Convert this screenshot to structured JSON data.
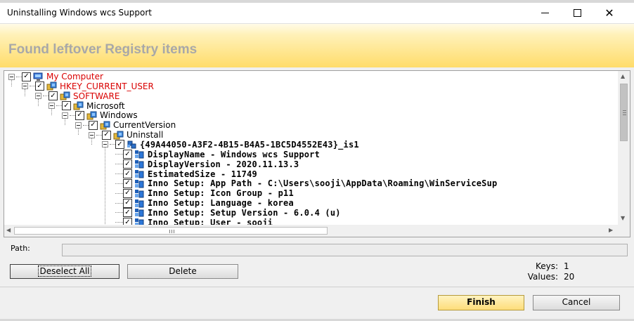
{
  "window": {
    "title": "Uninstalling Windows wcs Support",
    "minimize_icon": "minimize-icon",
    "maximize_icon": "maximize-icon",
    "close_icon": "close-icon"
  },
  "header": {
    "title": "Found leftover Registry items"
  },
  "tree": {
    "nodes": [
      {
        "label": "My Computer",
        "icon": "computer-icon",
        "checked": true,
        "style": "red"
      },
      {
        "label": "HKEY_CURRENT_USER",
        "icon": "registry-folder-icon",
        "checked": true,
        "style": "red"
      },
      {
        "label": "SOFTWARE",
        "icon": "registry-folder-icon",
        "checked": true,
        "style": "red"
      },
      {
        "label": "Microsoft",
        "icon": "registry-folder-icon",
        "checked": true,
        "style": "normal"
      },
      {
        "label": "Windows",
        "icon": "registry-folder-icon",
        "checked": true,
        "style": "normal"
      },
      {
        "label": "CurrentVersion",
        "icon": "registry-folder-icon",
        "checked": true,
        "style": "normal"
      },
      {
        "label": "Uninstall",
        "icon": "registry-folder-icon",
        "checked": true,
        "style": "normal"
      },
      {
        "label": "{49A44050-A3F2-4B15-B4A5-1BC5D4552E43}_is1",
        "icon": "registry-key-icon",
        "checked": true,
        "style": "mono"
      },
      {
        "label": "DisplayName - Windows wcs Support",
        "icon": "registry-value-icon",
        "checked": true,
        "style": "mono"
      },
      {
        "label": "DisplayVersion - 2020.11.13.3",
        "icon": "registry-value-icon",
        "checked": true,
        "style": "mono"
      },
      {
        "label": "EstimatedSize - 11749",
        "icon": "registry-value-icon",
        "checked": true,
        "style": "mono"
      },
      {
        "label": "Inno Setup: App Path - C:\\Users\\sooji\\AppData\\Roaming\\WinServiceSup",
        "icon": "registry-value-icon",
        "checked": true,
        "style": "mono"
      },
      {
        "label": "Inno Setup: Icon Group - p11",
        "icon": "registry-value-icon",
        "checked": true,
        "style": "mono"
      },
      {
        "label": "Inno Setup: Language - korea",
        "icon": "registry-value-icon",
        "checked": true,
        "style": "mono"
      },
      {
        "label": "Inno Setup: Setup Version - 6.0.4 (u)",
        "icon": "registry-value-icon",
        "checked": true,
        "style": "mono"
      },
      {
        "label": "Inno Setup: User - sooji",
        "icon": "registry-value-icon",
        "checked": true,
        "style": "mono"
      }
    ]
  },
  "path": {
    "label": "Path:",
    "value": ""
  },
  "actions": {
    "deselect_all": "Deselect All",
    "delete": "Delete"
  },
  "counts": {
    "keys_label": "Keys:",
    "keys_value": "1",
    "values_label": "Values:",
    "values_value": "20"
  },
  "footer": {
    "finish": "Finish",
    "cancel": "Cancel"
  },
  "colors": {
    "header_gradient_top": "#fffbe8",
    "header_gradient_bottom": "#ffdc6a",
    "header_text": "#a8a8a8",
    "red_node": "#d90000",
    "finish_button": "#fedd7a"
  }
}
